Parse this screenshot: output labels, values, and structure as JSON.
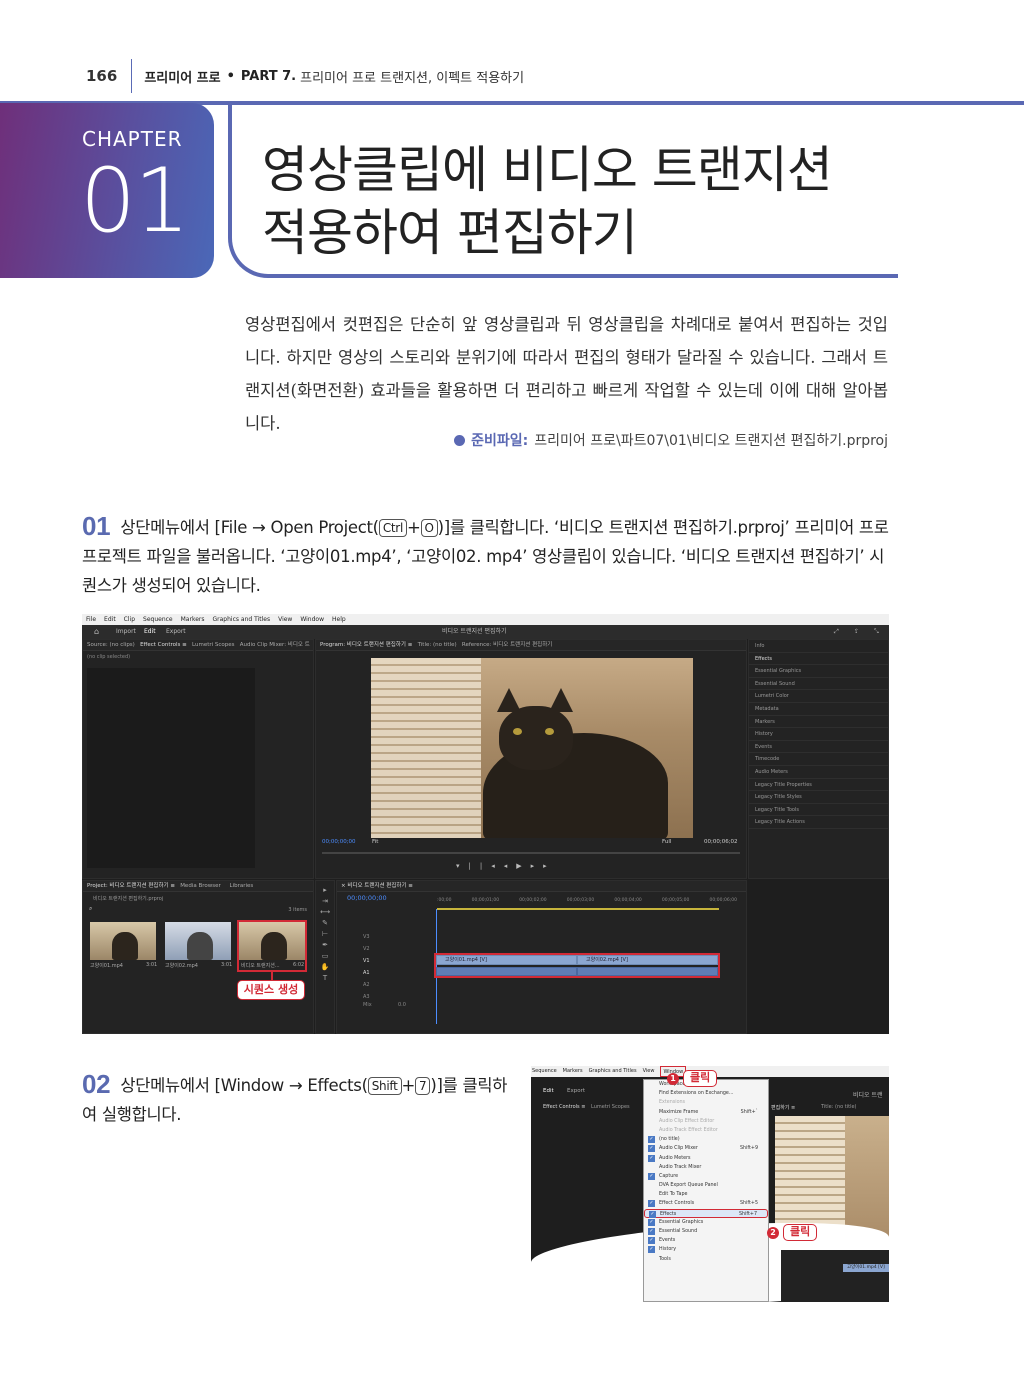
{
  "header": {
    "page_number": "166",
    "book": "프리미어 프로",
    "separator": "•",
    "part": "PART 7.",
    "part_title": "프리미어 프로 트랜지션, 이펙트 적용하기"
  },
  "chapter": {
    "label": "CHAPTER",
    "number": "01",
    "title_line1": "영상클립에 비디오 트랜지션",
    "title_line2": "적용하여 편집하기"
  },
  "intro": {
    "text": "영상편집에서 컷편집은 단순히 앞 영상클립과 뒤 영상클립을 차례대로 붙여서 편집하는 것입니다. 하지만 영상의 스토리와 분위기에 따라서 편집의 형태가 달라질 수 있습니다. 그래서 트랜지션(화면전환) 효과들을 활용하면 더 편리하고 빠르게 작업할 수 있는데 이에 대해 알아봅니다.",
    "prep_label": "준비파일:",
    "prep_path": "프리미어 프로\\파트07\\01\\비디오 트랜지션 편집하기.prproj"
  },
  "step1": {
    "number": "01",
    "text_a": "상단메뉴에서 [File → Open Project(",
    "key1": "Ctrl",
    "plus": "+",
    "key2": "O",
    "text_b": ")]를 클릭합니다. ‘비디오 트랜지션 편집하기.prproj’ 프리미어 프로 프로젝트 파일을 불러옵니다. ‘고양이01.mp4’, ‘고양이02. mp4’ 영상클립이 있습니다. ‘비디오 트랜지션 편집하기’ 시퀀스가 생성되어 있습니다."
  },
  "screenshot1": {
    "menu": [
      "File",
      "Edit",
      "Clip",
      "Sequence",
      "Markers",
      "Graphics and Titles",
      "View",
      "Window",
      "Help"
    ],
    "workspace_tabs": [
      "Import",
      "Edit",
      "Export"
    ],
    "app_title": "비디오 트랜지션 편집하기",
    "source_tabs": [
      "Source: (no clips)",
      "Effect Controls ≡",
      "Lumetri Scopes",
      "Audio Clip Mixer: 비디오 트"
    ],
    "no_clip": "(no clip selected)",
    "program_tab": "Program: 비디오 트랜지션 편집하기 ≡",
    "title_tab": "Title: (no title)",
    "reference_tab": "Reference: 비디오 트랜지션 편집하기",
    "timecode_left": "00;00;00;00",
    "fit": "Fit",
    "full": "Full",
    "timecode_right": "00;00;06;02",
    "side_panel": [
      "Info",
      "Effects",
      "Essential Graphics",
      "Essential Sound",
      "Lumetri Color",
      "Metadata",
      "Markers",
      "History",
      "Events",
      "Timecode",
      "Audio Meters",
      "Legacy Title Properties",
      "Legacy Title Styles",
      "Legacy Title Tools",
      "Legacy Title Actions"
    ],
    "project_tabs": [
      "Project: 비디오 트랜지션 편집하기 ≡",
      "Media Browser",
      "Libraries"
    ],
    "project_file": "비디오 트랜지션 편집하기.prproj",
    "items_count": "3 items",
    "bins": [
      {
        "name": "고양이01.mp4",
        "dur": "3:01"
      },
      {
        "name": "고양이02.mp4",
        "dur": "3:01"
      },
      {
        "name": "비디오 트랜지션...",
        "dur": "6:02"
      }
    ],
    "timeline_tab": "× 비디오 트랜지션 편집하기 ≡",
    "timeline_tc": "00;00;00;00",
    "ruler": [
      ":00;00",
      "00;00;01;00",
      "00;00;02;00",
      "00;00;03;00",
      "00;00;04;00",
      "00;00;05;00",
      "00;00;06;00"
    ],
    "tracks": [
      "V3",
      "V2",
      "V1",
      "A1",
      "A2",
      "A3",
      "Mix"
    ],
    "clip1": "고양이01.mp4 [V]",
    "clip2": "고양이02.mp4 [V]",
    "mix_value": "0.0",
    "seq_callout": "시퀀스 생성"
  },
  "step2": {
    "number": "02",
    "text_a": "상단메뉴에서 [Window → Effects(",
    "key1": "Shift",
    "plus": "+",
    "key2": "7",
    "text_b": ")]를 클릭하여 실행합니다."
  },
  "screenshot2": {
    "menu": [
      "Sequence",
      "Markers",
      "Graphics and Titles",
      "View",
      "Window"
    ],
    "ws": [
      "Edit",
      "Export"
    ],
    "ec_tab": "Effect Controls ≡",
    "lumetri": "Lumetri Scopes",
    "program_tab": "편집하기 ≡",
    "title_tab": "Title: (no title)",
    "right_title": "비디오 트랜",
    "menu_items": [
      {
        "label": "Workspaces",
        "shortcut": "",
        "check": false,
        "disabled": false
      },
      {
        "label": "Find Extensions on Exchange...",
        "shortcut": "",
        "check": false,
        "disabled": false
      },
      {
        "label": "Extensions",
        "shortcut": "",
        "check": false,
        "disabled": true
      },
      {
        "label": "Maximize Frame",
        "shortcut": "Shift+`",
        "check": false,
        "disabled": false
      },
      {
        "label": "Audio Clip Effect Editor",
        "shortcut": "",
        "check": false,
        "disabled": true
      },
      {
        "label": "Audio Track Effect Editor",
        "shortcut": "",
        "check": false,
        "disabled": true
      },
      {
        "label": "(no title)",
        "shortcut": "",
        "check": true,
        "disabled": false
      },
      {
        "label": "Audio Clip Mixer",
        "shortcut": "Shift+9",
        "check": true,
        "disabled": false
      },
      {
        "label": "Audio Meters",
        "shortcut": "",
        "check": true,
        "disabled": false
      },
      {
        "label": "Audio Track Mixer",
        "shortcut": "",
        "check": false,
        "disabled": false
      },
      {
        "label": "Capture",
        "shortcut": "",
        "check": true,
        "disabled": false
      },
      {
        "label": "DVA Export Queue Panel",
        "shortcut": "",
        "check": false,
        "disabled": false
      },
      {
        "label": "Edit To Tape",
        "shortcut": "",
        "check": false,
        "disabled": false
      },
      {
        "label": "Effect Controls",
        "shortcut": "Shift+5",
        "check": true,
        "disabled": false
      },
      {
        "label": "Effects",
        "shortcut": "Shift+7",
        "check": true,
        "disabled": false
      },
      {
        "label": "Essential Graphics",
        "shortcut": "",
        "check": true,
        "disabled": false
      },
      {
        "label": "Essential Sound",
        "shortcut": "",
        "check": true,
        "disabled": false
      },
      {
        "label": "Events",
        "shortcut": "",
        "check": true,
        "disabled": false
      },
      {
        "label": "History",
        "shortcut": "",
        "check": true,
        "disabled": false
      },
      {
        "label": "Tools",
        "shortcut": "",
        "check": false,
        "disabled": false
      }
    ],
    "clip": "고양이01.mp4 [V]",
    "callout1_num": "1",
    "callout1": "클릭",
    "callout2_num": "2",
    "callout2": "클릭"
  }
}
